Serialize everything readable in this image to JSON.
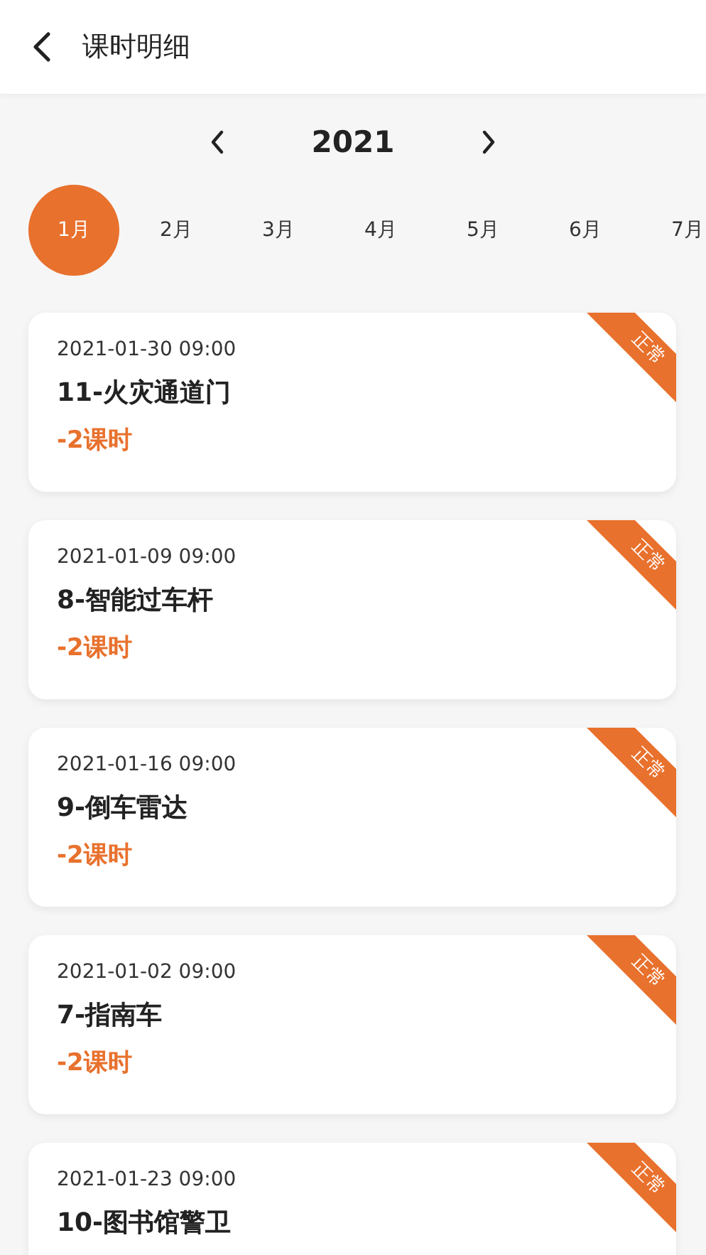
{
  "header": {
    "title": "课时明细"
  },
  "year": "2021",
  "months": [
    {
      "label": "1月",
      "selected": true
    },
    {
      "label": "2月",
      "selected": false
    },
    {
      "label": "3月",
      "selected": false
    },
    {
      "label": "4月",
      "selected": false
    },
    {
      "label": "5月",
      "selected": false
    },
    {
      "label": "6月",
      "selected": false
    },
    {
      "label": "7月",
      "selected": false
    }
  ],
  "records": [
    {
      "time": "2021-01-30 09:00",
      "title": "11-火灾通道门",
      "hours": "-2课时",
      "status": "正常"
    },
    {
      "time": "2021-01-09 09:00",
      "title": "8-智能过车杆",
      "hours": "-2课时",
      "status": "正常"
    },
    {
      "time": "2021-01-16 09:00",
      "title": "9-倒车雷达",
      "hours": "-2课时",
      "status": "正常"
    },
    {
      "time": "2021-01-02 09:00",
      "title": "7-指南车",
      "hours": "-2课时",
      "status": "正常"
    },
    {
      "time": "2021-01-23 09:00",
      "title": "10-图书馆警卫",
      "status": "正常"
    }
  ]
}
